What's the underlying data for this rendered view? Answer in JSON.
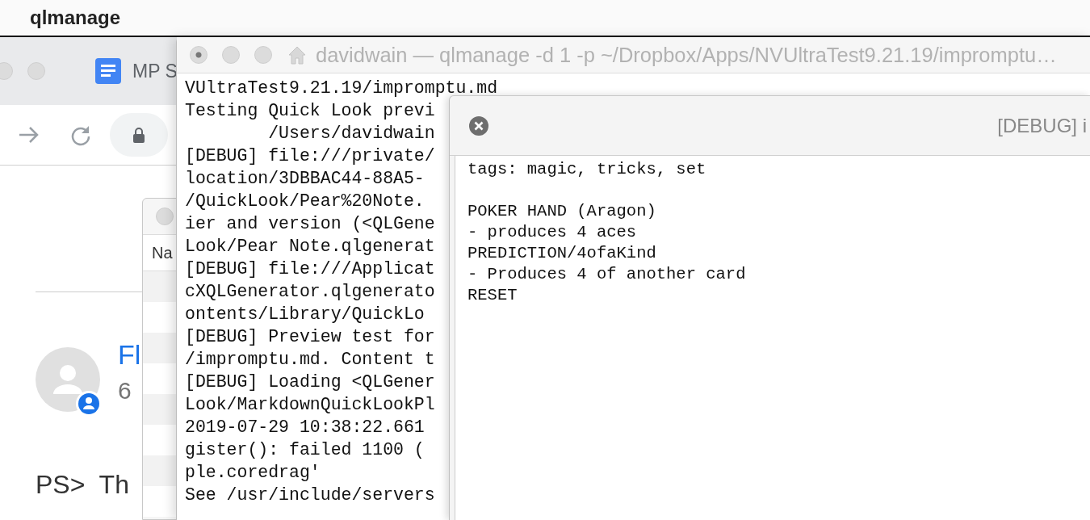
{
  "menu_bar": {
    "app_name": "qlmanage"
  },
  "browser": {
    "tab": {
      "title": "MP S"
    },
    "post": {
      "author": "Fl",
      "time": "6",
      "body": "PS>  Th"
    }
  },
  "finder": {
    "column_header": "Na"
  },
  "terminal": {
    "title": "davidwain — qlmanage -d 1 -p ~/Dropbox/Apps/NVUltraTest9.21.19/impromptu…",
    "lines": [
      "VUltraTest9.21.19/impromptu.md",
      "Testing Quick Look previ",
      "        /Users/davidwain",
      "[DEBUG] file:///private/",
      "location/3DBBAC44-88A5-",
      "/QuickLook/Pear%20Note.",
      "ier and version (<QLGene",
      "Look/Pear Note.qlgenerat",
      "[DEBUG] file:///Applicat",
      "cXQLGenerator.qlgenerato",
      "ontents/Library/QuickLo",
      "[DEBUG] Preview test for",
      "/impromptu.md. Content t",
      "[DEBUG] Loading <QLGener",
      "Look/MarkdownQuickLookPl",
      "2019-07-29 10:38:22.661",
      "gister(): failed 1100 (",
      "ple.coredrag'",
      "See /usr/include/servers"
    ]
  },
  "preview": {
    "title": "[DEBUG] i",
    "blocks": [
      [
        "tags: magic, tricks, set"
      ],
      [
        "POKER HAND (Aragon)",
        "- produces 4 aces",
        "PREDICTION/4ofaKind",
        "- Produces 4 of another card",
        "RESET"
      ]
    ]
  }
}
